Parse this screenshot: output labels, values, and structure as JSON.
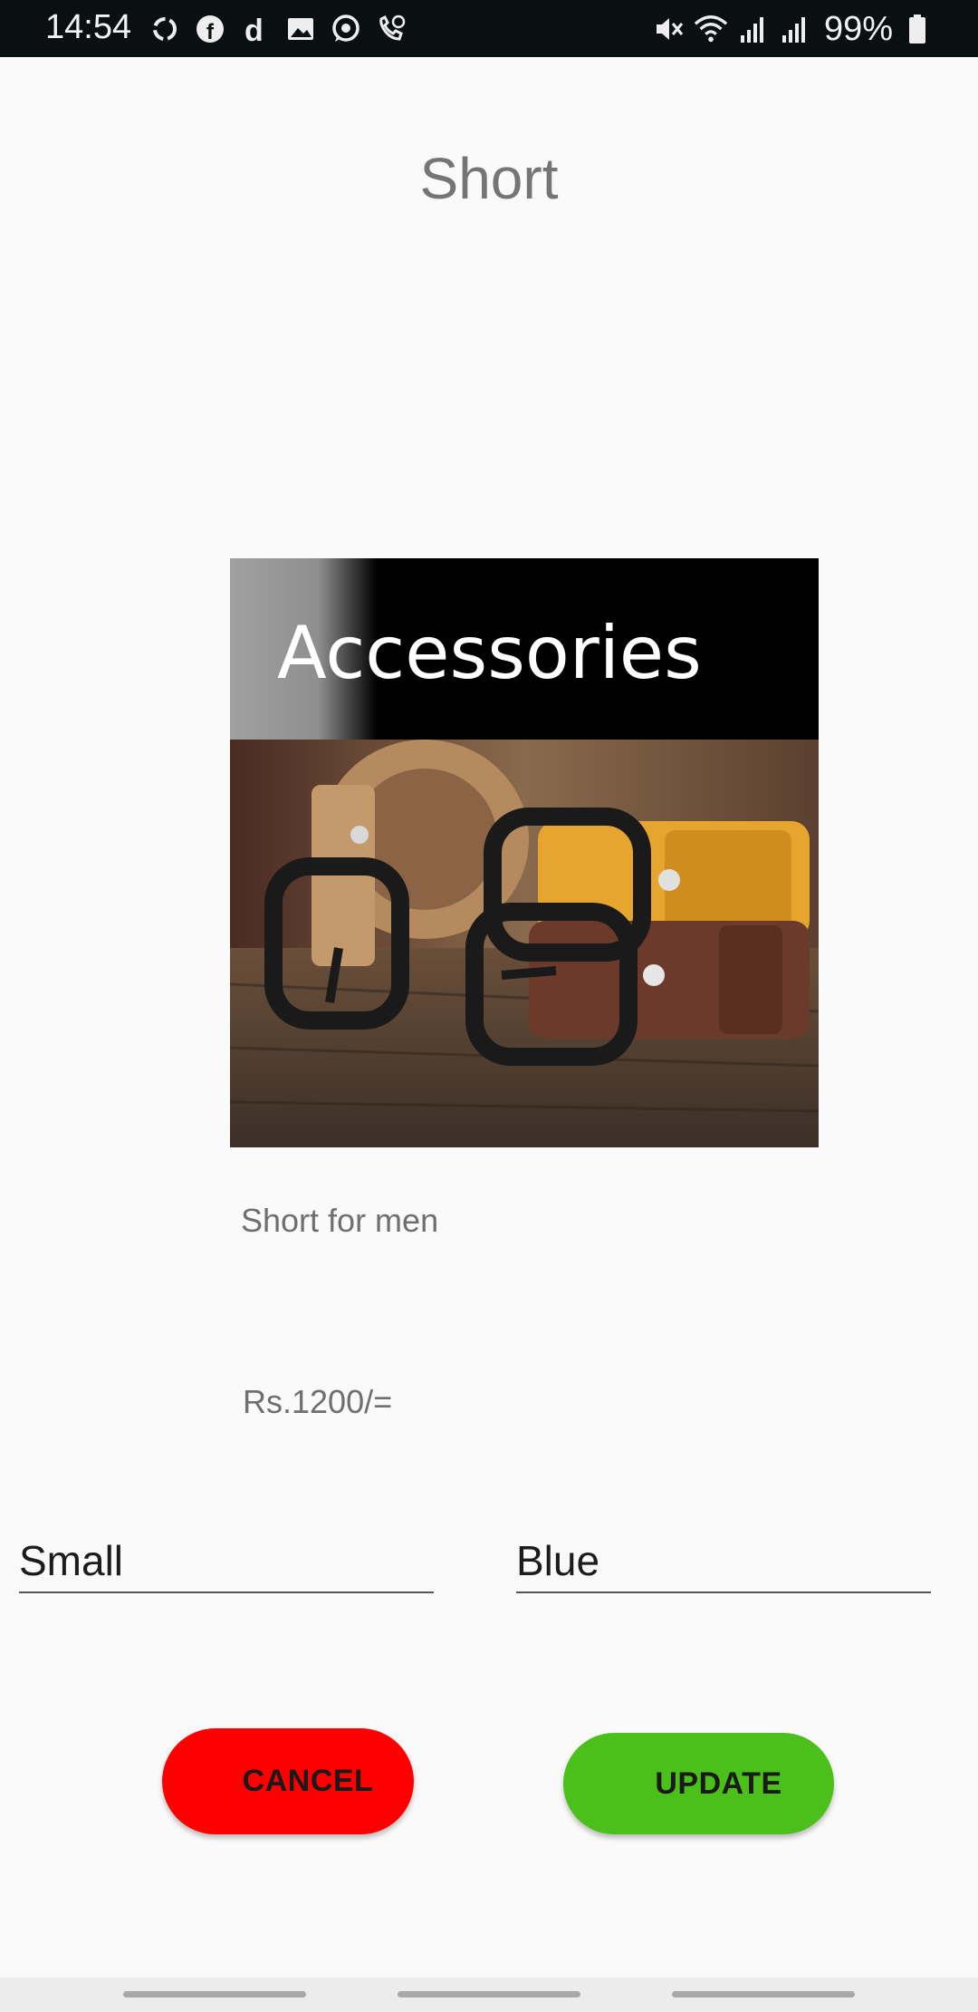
{
  "status_bar": {
    "time": "14:54",
    "battery": "99%",
    "notification_icons": [
      "sync-icon",
      "facebook-icon",
      "d-app-icon",
      "gallery-icon",
      "whatsapp-icon",
      "missed-call-icon"
    ],
    "system_icons": [
      "mute-icon",
      "wifi-icon",
      "signal-icon",
      "signal-icon",
      "battery-icon"
    ]
  },
  "page": {
    "title": "Short"
  },
  "product": {
    "image_text": "Accessories",
    "description": "Short for men",
    "price": "Rs.1200/="
  },
  "form": {
    "size_value": "Small",
    "color_value": "Blue"
  },
  "buttons": {
    "cancel_label": "CANCEL",
    "update_label": "UPDATE"
  },
  "colors": {
    "cancel": "#ff0000",
    "update": "#4bbf1a",
    "background": "#fafafa"
  }
}
